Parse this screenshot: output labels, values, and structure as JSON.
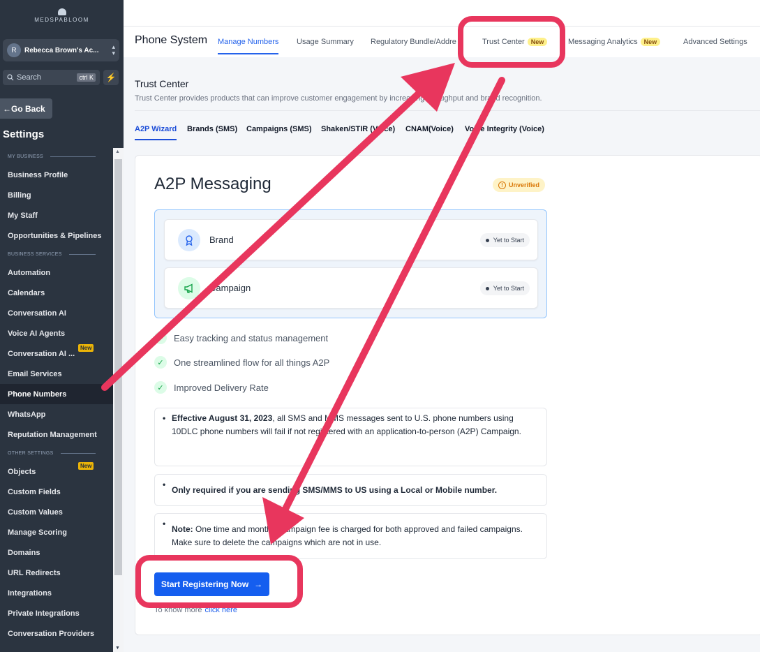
{
  "sidebar": {
    "logo": "MEDSPABLOOM",
    "account": {
      "initial": "R",
      "name": "Rebecca Brown's Ac..."
    },
    "search": {
      "placeholder": "Search",
      "shortcut": "ctrl K"
    },
    "go_back": "Go Back",
    "title": "Settings",
    "sections": [
      {
        "label": "MY BUSINESS",
        "items": [
          {
            "label": "Business Profile"
          },
          {
            "label": "Billing"
          },
          {
            "label": "My Staff"
          },
          {
            "label": "Opportunities & Pipelines"
          }
        ]
      },
      {
        "label": "BUSINESS SERVICES",
        "items": [
          {
            "label": "Automation"
          },
          {
            "label": "Calendars"
          },
          {
            "label": "Conversation AI"
          },
          {
            "label": "Voice AI Agents"
          },
          {
            "label": "Conversation AI ...",
            "badge": "New"
          },
          {
            "label": "Email Services"
          },
          {
            "label": "Phone Numbers",
            "active": true
          },
          {
            "label": "WhatsApp"
          },
          {
            "label": "Reputation Management"
          }
        ]
      },
      {
        "label": "OTHER SETTINGS",
        "items": [
          {
            "label": "Objects",
            "badge": "New"
          },
          {
            "label": "Custom Fields"
          },
          {
            "label": "Custom Values"
          },
          {
            "label": "Manage Scoring"
          },
          {
            "label": "Domains"
          },
          {
            "label": "URL Redirects"
          },
          {
            "label": "Integrations"
          },
          {
            "label": "Private Integrations"
          },
          {
            "label": "Conversation Providers"
          }
        ]
      }
    ]
  },
  "header": {
    "title": "Phone System",
    "tabs": [
      {
        "label": "Manage Numbers",
        "active": true
      },
      {
        "label": "Usage Summary"
      },
      {
        "label": "Regulatory Bundle/Addre"
      },
      {
        "label": "Trust Center",
        "badge": "New"
      },
      {
        "label": "Messaging Analytics",
        "badge": "New"
      },
      {
        "label": "Advanced Settings"
      }
    ]
  },
  "trust_center": {
    "title": "Trust Center",
    "description": "Trust Center provides products that can improve customer engagement by increasing throughput and brand recognition.",
    "tabs": [
      "A2P Wizard",
      "Brands (SMS)",
      "Campaigns (SMS)",
      "Shaken/STIR (Voice)",
      "CNAM(Voice)",
      "Voice Integrity (Voice)"
    ]
  },
  "a2p": {
    "title": "A2P Messaging",
    "status": "Unverified",
    "steps": [
      {
        "label": "Brand",
        "status": "Yet to Start",
        "icon": "ribbon-icon"
      },
      {
        "label": "Campaign",
        "status": "Yet to Start",
        "icon": "megaphone-icon"
      }
    ],
    "features": [
      "Easy tracking and status management",
      "One streamlined flow for all things A2P",
      "Improved Delivery Rate"
    ],
    "notes": [
      {
        "bold": "Effective August 31, 2023",
        "text": ", all SMS and MMS messages sent to U.S. phone numbers using 10DLC phone numbers will fail if not registered with an application-to-person (A2P) Campaign."
      },
      {
        "bold": "Only required if you are sending SMS/MMS to US using a Local or Mobile number.",
        "text": ""
      },
      {
        "bold": "Note:",
        "text": " One time and monthly campaign fee is charged for both approved and failed campaigns. Make sure to delete the campaigns which are not in use."
      }
    ],
    "cta": "Start Registering Now",
    "more_text": "To know more",
    "more_link": "click here"
  },
  "annotation": {
    "color": "#e8365d"
  }
}
